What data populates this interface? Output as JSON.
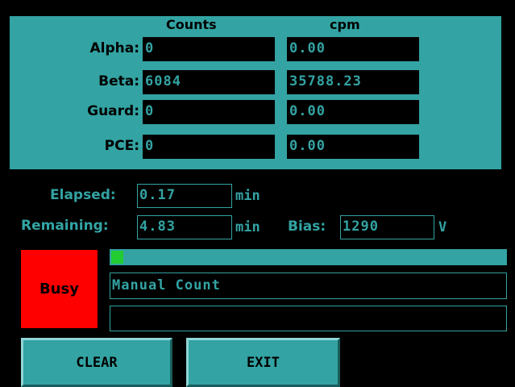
{
  "counts_panel": {
    "headers": {
      "counts": "Counts",
      "cpm": "cpm"
    },
    "rows": [
      {
        "label": "Alpha:",
        "counts": "0",
        "cpm": "0.00"
      },
      {
        "label": "Beta:",
        "counts": "6084",
        "cpm": "35788.23"
      },
      {
        "label": "Guard:",
        "counts": "0",
        "cpm": "0.00"
      },
      {
        "label": "PCE:",
        "counts": "0",
        "cpm": "0.00"
      }
    ]
  },
  "timing": {
    "elapsed_label": "Elapsed:",
    "elapsed_value": "0.17",
    "elapsed_unit": "min",
    "remaining_label": "Remaining:",
    "remaining_value": "4.83",
    "remaining_unit": "min",
    "bias_label": "Bias:",
    "bias_value": "1290",
    "bias_unit": "V"
  },
  "status": {
    "state": "Busy",
    "progress_fraction": 0.03,
    "message": "Manual Count",
    "message2": ""
  },
  "buttons": {
    "clear": "CLEAR",
    "exit": "EXIT"
  },
  "colors": {
    "panel": "#33a3a3",
    "background": "#000000",
    "busy": "#ff0000",
    "progress": "#22cc33"
  }
}
